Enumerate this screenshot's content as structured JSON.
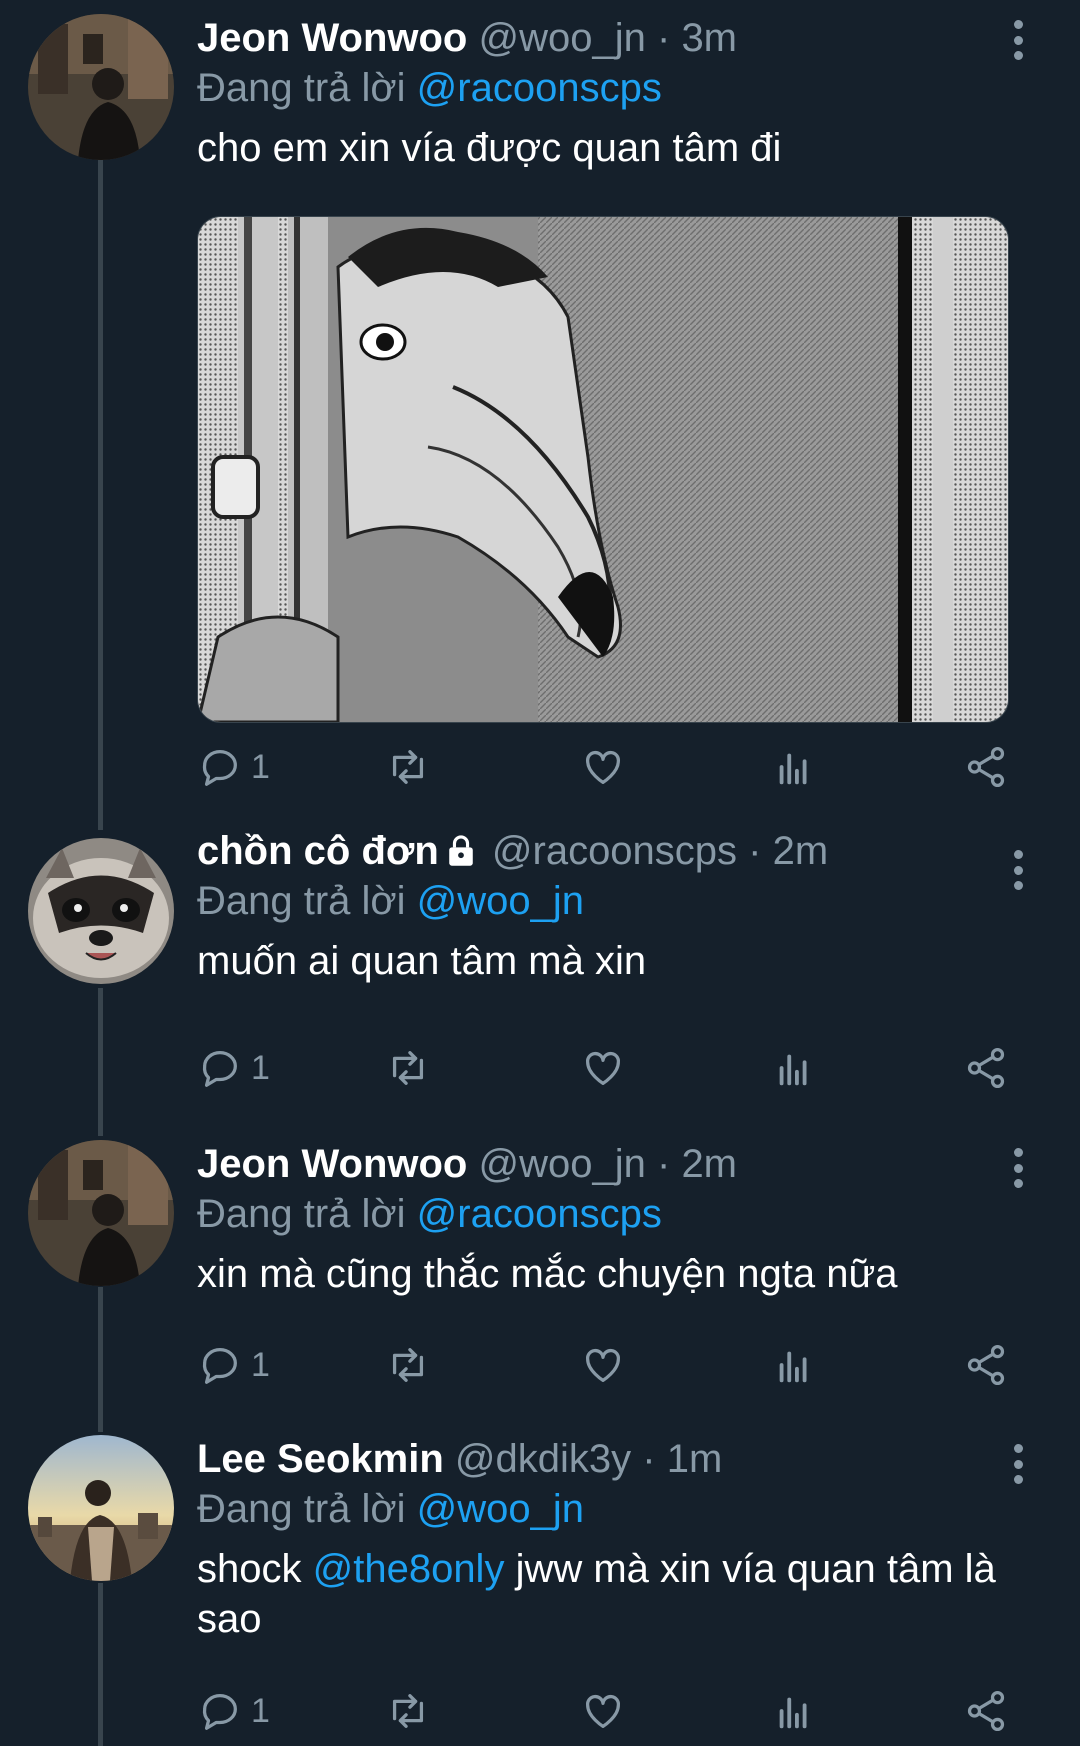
{
  "reply_prefix": "Đang trả lời",
  "colors": {
    "background": "#15202b",
    "secondary_text": "#8899a6",
    "link": "#1da1f2",
    "divider": "#38444d"
  },
  "tweets": [
    {
      "name": "Jeon Wonwoo",
      "handle": "@woo_jn",
      "time": "3m",
      "reply_to": "@racoonscps",
      "text": "cho em xin vía được quan tâm đi",
      "has_media": true,
      "reply_count": "1"
    },
    {
      "name": "chồn cô đơn",
      "handle": "@racoonscps",
      "time": "2m",
      "reply_to": "@woo_jn",
      "text": "muốn ai quan tâm mà xin",
      "locked": true,
      "reply_count": "1"
    },
    {
      "name": "Jeon Wonwoo",
      "handle": "@woo_jn",
      "time": "2m",
      "reply_to": "@racoonscps",
      "text": "xin mà cũng thắc mắc chuyện ngta nữa",
      "reply_count": "1"
    },
    {
      "name": "Lee Seokmin",
      "handle": "@dkdik3y",
      "time": "1m",
      "reply_to": "@woo_jn",
      "text_before": "shock ",
      "text_mention": "@the8only",
      "text_after": " jww mà xin vía quan tâm là sao",
      "reply_count": "1"
    }
  ],
  "icons": [
    "reply-icon",
    "retweet-icon",
    "like-icon",
    "analytics-icon",
    "share-icon",
    "more-options-icon",
    "lock-icon"
  ]
}
